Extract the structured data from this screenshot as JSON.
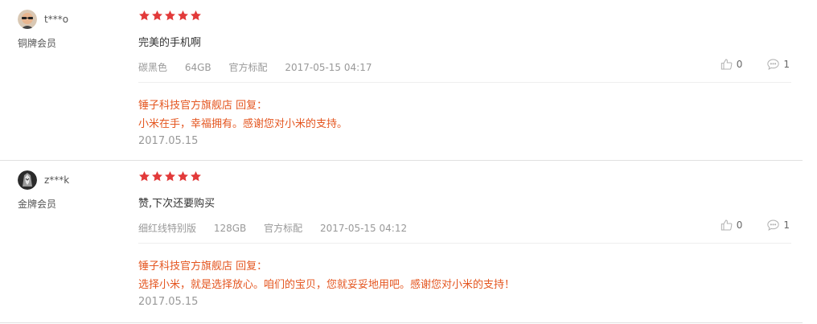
{
  "colors": {
    "star": "#e23a3a",
    "reply": "#e4551f",
    "meta": "#999999"
  },
  "reviews": [
    {
      "user": {
        "name": "t***o",
        "level": "铜牌会员",
        "avatar_icon": "avatar-photo"
      },
      "rating": 5,
      "text": "完美的手机啊",
      "meta": {
        "color": "碳黑色",
        "storage": "64GB",
        "package": "官方标配",
        "time": "2017-05-15 04:17"
      },
      "likes": "0",
      "comments": "1",
      "reply": {
        "head": "锤子科技官方旗舰店 回复：",
        "body": "小米在手，幸福拥有。感谢您对小米的支持。",
        "date": "2017.05.15"
      }
    },
    {
      "user": {
        "name": "z***k",
        "level": "金牌会员",
        "avatar_icon": "avatar-photo"
      },
      "rating": 5,
      "text": "赞,下次还要购买",
      "meta": {
        "color": "细红线特别版",
        "storage": "128GB",
        "package": "官方标配",
        "time": "2017-05-15 04:12"
      },
      "likes": "0",
      "comments": "1",
      "reply": {
        "head": "锤子科技官方旗舰店 回复：",
        "body": "选择小米，就是选择放心。咱们的宝贝，您就妥妥地用吧。感谢您对小米的支持！",
        "date": "2017.05.15"
      }
    }
  ]
}
